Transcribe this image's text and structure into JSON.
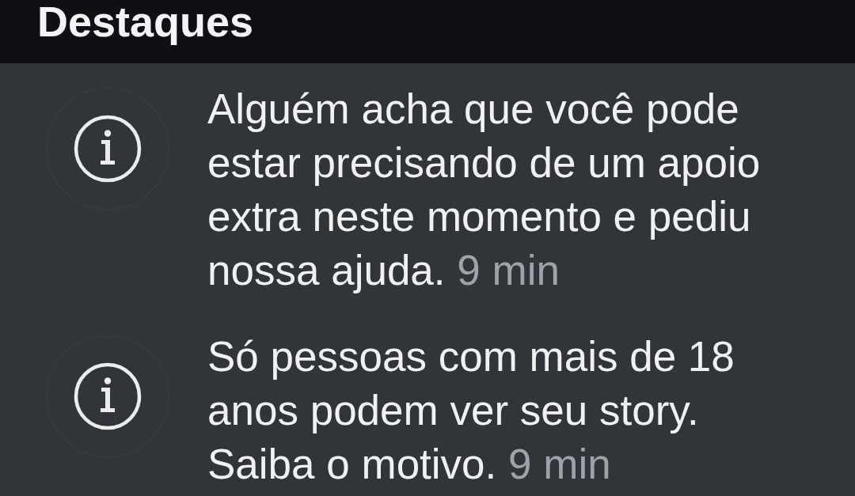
{
  "header": {
    "title": "Destaques"
  },
  "notifications": [
    {
      "text": "Alguém acha que você pode estar precisando de um apoio extra neste momento e pediu nossa ajuda.",
      "time": "9 min"
    },
    {
      "text": "Só pessoas com mais de 18 anos podem ver seu story. Saiba o motivo.",
      "time": "9 min"
    }
  ]
}
